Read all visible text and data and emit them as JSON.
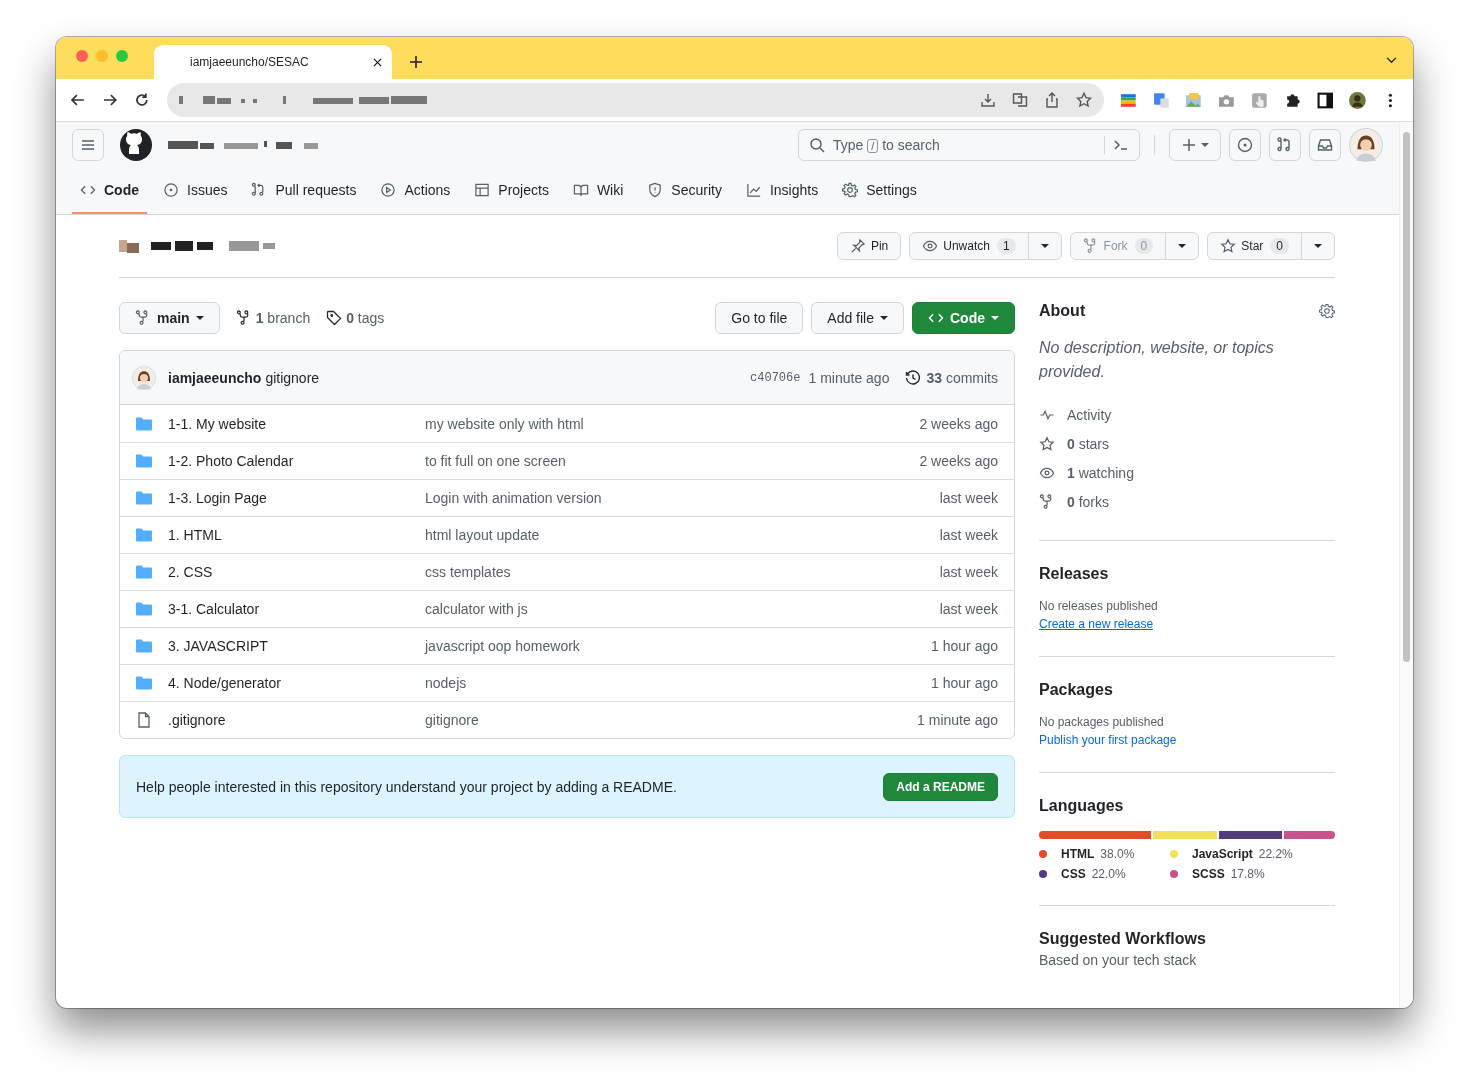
{
  "browser": {
    "tab_title": "iamjaeeuncho/SESAC"
  },
  "header": {
    "search": {
      "before": "Type",
      "key": "/",
      "after": "to search"
    }
  },
  "nav_tabs": [
    {
      "label": "Code",
      "selected": true
    },
    {
      "label": "Issues",
      "selected": false
    },
    {
      "label": "Pull requests",
      "selected": false
    },
    {
      "label": "Actions",
      "selected": false
    },
    {
      "label": "Projects",
      "selected": false
    },
    {
      "label": "Wiki",
      "selected": false
    },
    {
      "label": "Security",
      "selected": false
    },
    {
      "label": "Insights",
      "selected": false
    },
    {
      "label": "Settings",
      "selected": false
    }
  ],
  "repo_actions": [
    {
      "label": "Pin",
      "dropdown": false,
      "disabled": false
    },
    {
      "label": "Unwatch",
      "count": "1",
      "dropdown": true,
      "disabled": false
    },
    {
      "label": "Fork",
      "count": "0",
      "dropdown": true,
      "disabled": true
    },
    {
      "label": "Star",
      "count": "0",
      "dropdown": true,
      "disabled": false
    }
  ],
  "branch": {
    "name": "main",
    "branches": "**1** branch",
    "tags": "**0** tags"
  },
  "file_buttons": [
    {
      "label": "Go to file",
      "kind": "plain"
    },
    {
      "label": "Add file",
      "kind": "menu"
    },
    {
      "label": "Code",
      "kind": "primary"
    }
  ],
  "commit": {
    "author": "iamjaeeuncho",
    "message": "gitignore",
    "sha": "c40706e",
    "time": "1 minute ago",
    "count": "**33** commits"
  },
  "files": [
    {
      "kind": "folder",
      "name": "1-1. My website",
      "message": "my website only with html",
      "time": "2 weeks ago"
    },
    {
      "kind": "folder",
      "name": "1-2. Photo Calendar",
      "message": "to fit full on one screen",
      "time": "2 weeks ago"
    },
    {
      "kind": "folder",
      "name": "1-3. Login Page",
      "message": "Login with animation version",
      "time": "last week"
    },
    {
      "kind": "folder",
      "name": "1. HTML",
      "message": "html layout update",
      "time": "last week"
    },
    {
      "kind": "folder",
      "name": "2. CSS",
      "message": "css templates",
      "time": "last week"
    },
    {
      "kind": "folder",
      "name": "3-1. Calculator",
      "message": "calculator with js",
      "time": "last week"
    },
    {
      "kind": "folder",
      "name": "3. JAVASCRIPT",
      "message": "javascript oop homework",
      "time": "1 hour ago"
    },
    {
      "kind": "folder",
      "name": "4. Node/generator",
      "message": "nodejs",
      "time": "1 hour ago"
    },
    {
      "kind": "file",
      "name": ".gitignore",
      "message": "gitignore",
      "time": "1 minute ago"
    }
  ],
  "readme_banner": {
    "text": "Help people interested in this repository understand your project by adding a README.",
    "button": "Add a README"
  },
  "about": {
    "title": "About",
    "description": "No description, website, or topics provided.",
    "stats": [
      {
        "text": "Activity"
      },
      {
        "text": "**0** stars"
      },
      {
        "text": "**1** watching"
      },
      {
        "text": "**0** forks"
      }
    ]
  },
  "releases": {
    "title": "Releases",
    "note": "No releases published",
    "link": "Create a new release"
  },
  "packages": {
    "title": "Packages",
    "note": "No packages published",
    "link": "Publish your first package"
  },
  "languages": {
    "title": "Languages",
    "items": [
      {
        "name": "HTML",
        "percent": "38.0%",
        "color": "#e34c26"
      },
      {
        "name": "JavaScript",
        "percent": "22.2%",
        "color": "#f1e05a"
      },
      {
        "name": "CSS",
        "percent": "22.0%",
        "color": "#563d7c"
      },
      {
        "name": "SCSS",
        "percent": "17.8%",
        "color": "#c6538c"
      }
    ]
  },
  "workflows": {
    "title": "Suggested Workflows",
    "subtitle": "Based on your tech stack"
  }
}
